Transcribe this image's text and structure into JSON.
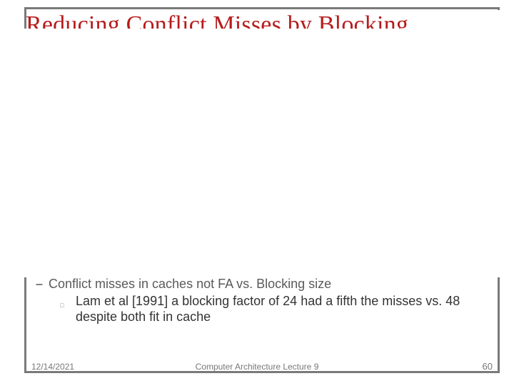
{
  "slide": {
    "title": "Reducing Conflict Misses by Blocking",
    "bullet": {
      "text": "Conflict misses in caches not FA vs. Blocking size",
      "sub": "Lam et al [1991] a blocking factor of 24 had a fifth the misses vs. 48 despite both fit in cache"
    },
    "footer": {
      "date": "12/14/2021",
      "center": "Computer Architecture Lecture 9",
      "page": "60"
    }
  }
}
